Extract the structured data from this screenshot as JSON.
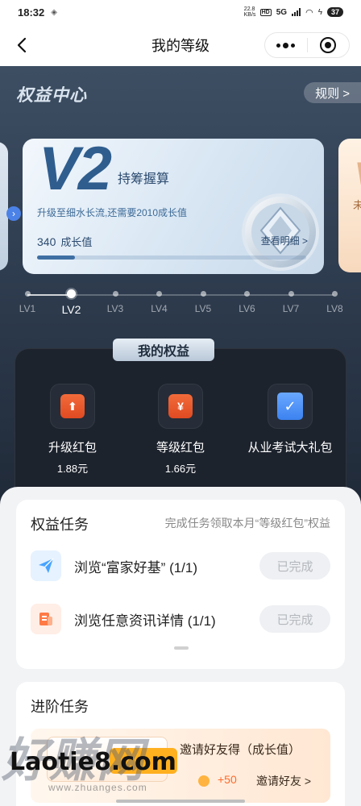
{
  "status": {
    "time": "18:32",
    "speed_value": "22.8",
    "speed_unit": "KB/s",
    "hd": "HD",
    "net": "5G",
    "battery": "37"
  },
  "nav": {
    "title": "我的等级"
  },
  "hero": {
    "title": "权益中心",
    "rules_label": "规则 >",
    "level_code": "V2",
    "level_name": "持筹握算",
    "upgrade_text": "升级至细水长流,还需要2010成长值",
    "growth_value": "340",
    "growth_label": "成长值",
    "detail_link": "查看明细 >",
    "progress": 0.14,
    "next_card_text": "未"
  },
  "levels": [
    "LV1",
    "LV2",
    "LV3",
    "LV4",
    "LV5",
    "LV6",
    "LV7",
    "LV8"
  ],
  "active_level": "LV2",
  "benefits": {
    "title": "我的权益",
    "items": [
      {
        "label": "升级红包",
        "value": "1.88元",
        "icon": "upgrade-redpacket-icon",
        "glyph": "⬆"
      },
      {
        "label": "等级红包",
        "value": "1.66元",
        "icon": "level-redpacket-icon",
        "glyph": "¥"
      },
      {
        "label": "从业考试大礼包",
        "value": "",
        "icon": "exam-gift-icon",
        "glyph": "✓"
      }
    ]
  },
  "tasks": {
    "title": "权益任务",
    "subtitle": "完成任务领取本月“等级红包”权益",
    "items": [
      {
        "name": "浏览“富家好基”",
        "progress": "(1/1)",
        "status": "已完成",
        "icon": "paper-plane-icon"
      },
      {
        "name": "浏览任意资讯详情",
        "progress": "(1/1)",
        "status": "已完成",
        "icon": "news-icon"
      }
    ]
  },
  "advanced": {
    "title": "进阶任务",
    "invite_title": "邀请好友得（成长值）",
    "bonus": "+50",
    "invite_link": "邀请好友 >"
  },
  "watermark": {
    "big": "好赚网",
    "site": "Laotie8.com",
    "sub": "www.zhuanges.com"
  },
  "colors": {
    "hero_bg": "#2f3d50",
    "accent_blue": "#3f6fa3",
    "red_packet": "#e04a22",
    "orange_bonus": "#ff6a2c"
  }
}
